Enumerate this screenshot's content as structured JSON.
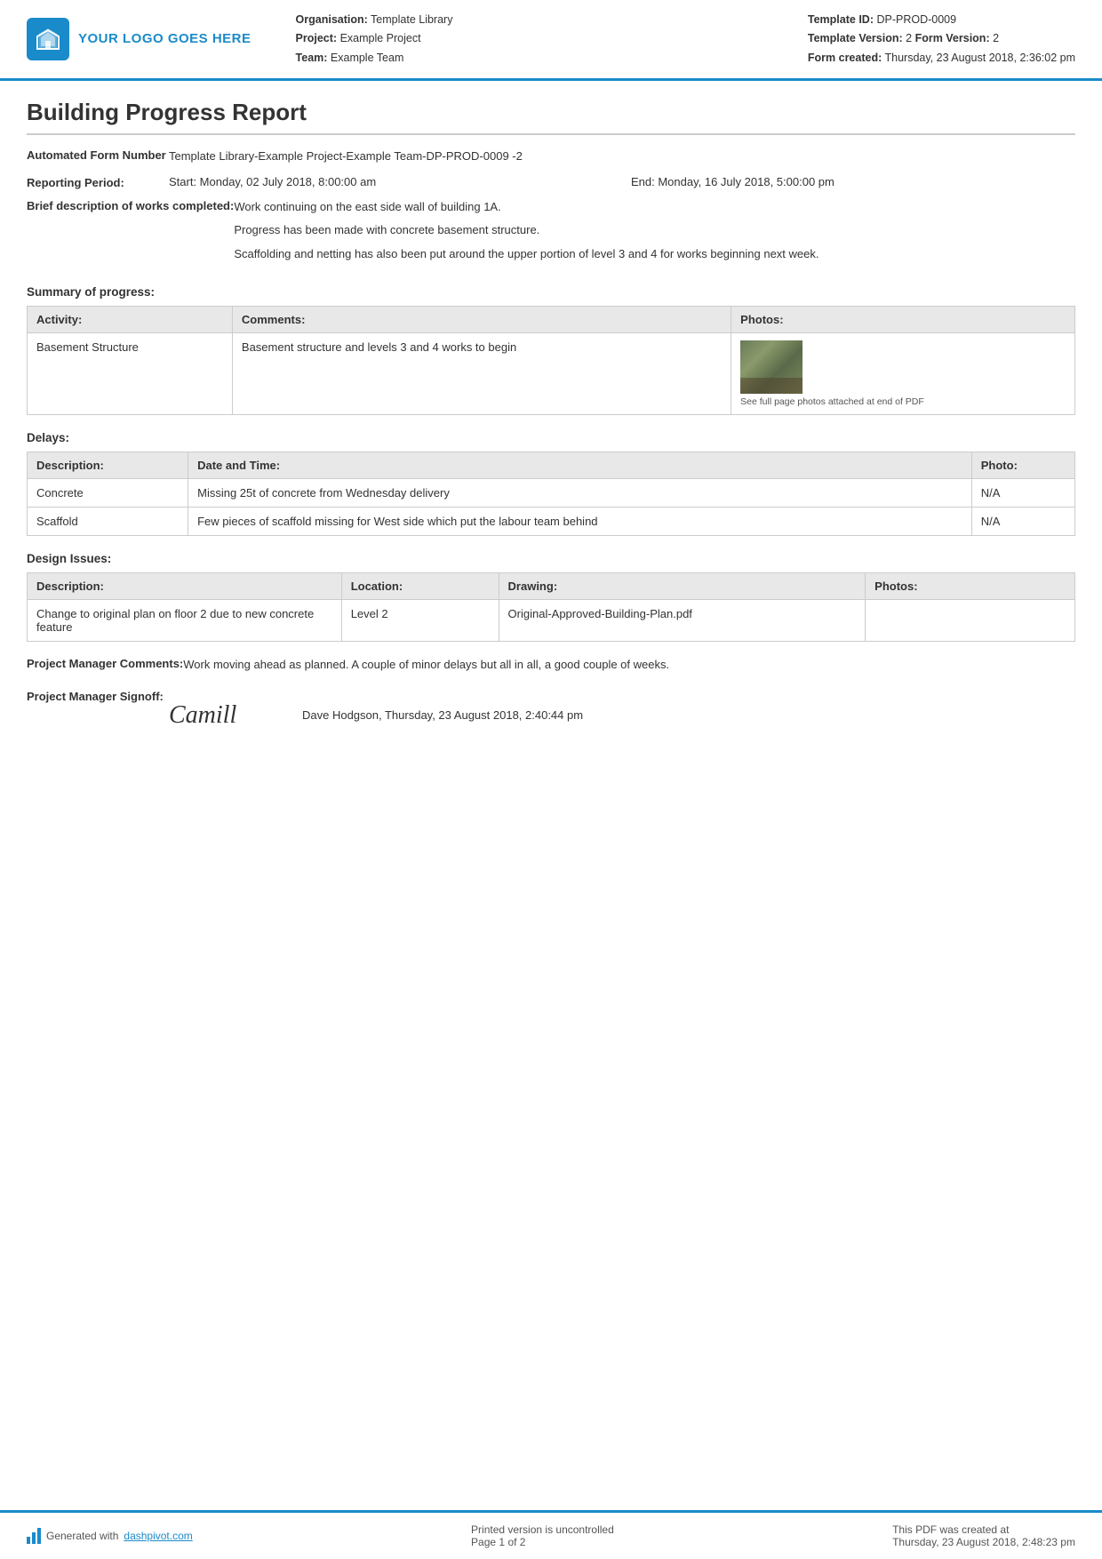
{
  "header": {
    "logo_text": "YOUR LOGO GOES HERE",
    "org_label": "Organisation:",
    "org_value": "Template Library",
    "project_label": "Project:",
    "project_value": "Example Project",
    "team_label": "Team:",
    "team_value": "Example Team",
    "template_id_label": "Template ID:",
    "template_id_value": "DP-PROD-0009",
    "template_version_label": "Template Version:",
    "template_version_value": "2",
    "form_version_label": "Form Version:",
    "form_version_value": "2",
    "form_created_label": "Form created:",
    "form_created_value": "Thursday, 23 August 2018, 2:36:02 pm"
  },
  "report": {
    "title": "Building Progress Report",
    "automated_form_number_label": "Automated Form Number",
    "automated_form_number_value": "Template Library-Example Project-Example Team-DP-PROD-0009   -2",
    "reporting_period_label": "Reporting Period:",
    "reporting_start": "Start: Monday, 02 July 2018, 8:00:00 am",
    "reporting_end": "End: Monday, 16 July 2018, 5:00:00 pm",
    "brief_description_label": "Brief description of works completed:",
    "brief_description_lines": [
      "Work continuing on the east side wall of building 1A.",
      "Progress has been made with concrete basement structure.",
      "Scaffolding and netting has also been put around the upper portion of level 3 and 4 for works beginning next week."
    ],
    "summary_section_title": "Summary of progress:",
    "summary_table": {
      "headers": [
        "Activity:",
        "Comments:",
        "Photos:"
      ],
      "rows": [
        {
          "activity": "Basement Structure",
          "comments": "Basement structure and levels 3 and 4 works to begin",
          "photo_caption": "See full page photos attached at end of PDF"
        }
      ]
    },
    "delays_section_title": "Delays:",
    "delays_table": {
      "headers": [
        "Description:",
        "Date and Time:",
        "Photo:"
      ],
      "rows": [
        {
          "description": "Concrete",
          "date_time": "Missing 25t of concrete from Wednesday delivery",
          "photo": "N/A"
        },
        {
          "description": "Scaffold",
          "date_time": "Few pieces of scaffold missing for West side which put the labour team behind",
          "photo": "N/A"
        }
      ]
    },
    "design_issues_section_title": "Design Issues:",
    "design_issues_table": {
      "headers": [
        "Description:",
        "Location:",
        "Drawing:",
        "Photos:"
      ],
      "rows": [
        {
          "description": "Change to original plan on floor 2 due to new concrete feature",
          "location": "Level 2",
          "drawing": "Original-Approved-Building-Plan.pdf",
          "photos": ""
        }
      ]
    },
    "pm_comments_label": "Project Manager Comments:",
    "pm_comments_value": "Work moving ahead as planned. A couple of minor delays but all in all, a good couple of weeks.",
    "pm_signoff_label": "Project Manager Signoff:",
    "pm_signature_display": "Camill",
    "pm_signature_text": "Dave Hodgson, Thursday, 23 August 2018, 2:40:44 pm"
  },
  "footer": {
    "generated_text": "Generated with ",
    "generated_link": "dashpivot.com",
    "printed_version_text": "Printed version is uncontrolled",
    "page_label": "Page",
    "page_number": "1",
    "page_of": "of 2",
    "pdf_created_label": "This PDF was created at",
    "pdf_created_value": "Thursday, 23 August 2018, 2:48:23 pm"
  }
}
